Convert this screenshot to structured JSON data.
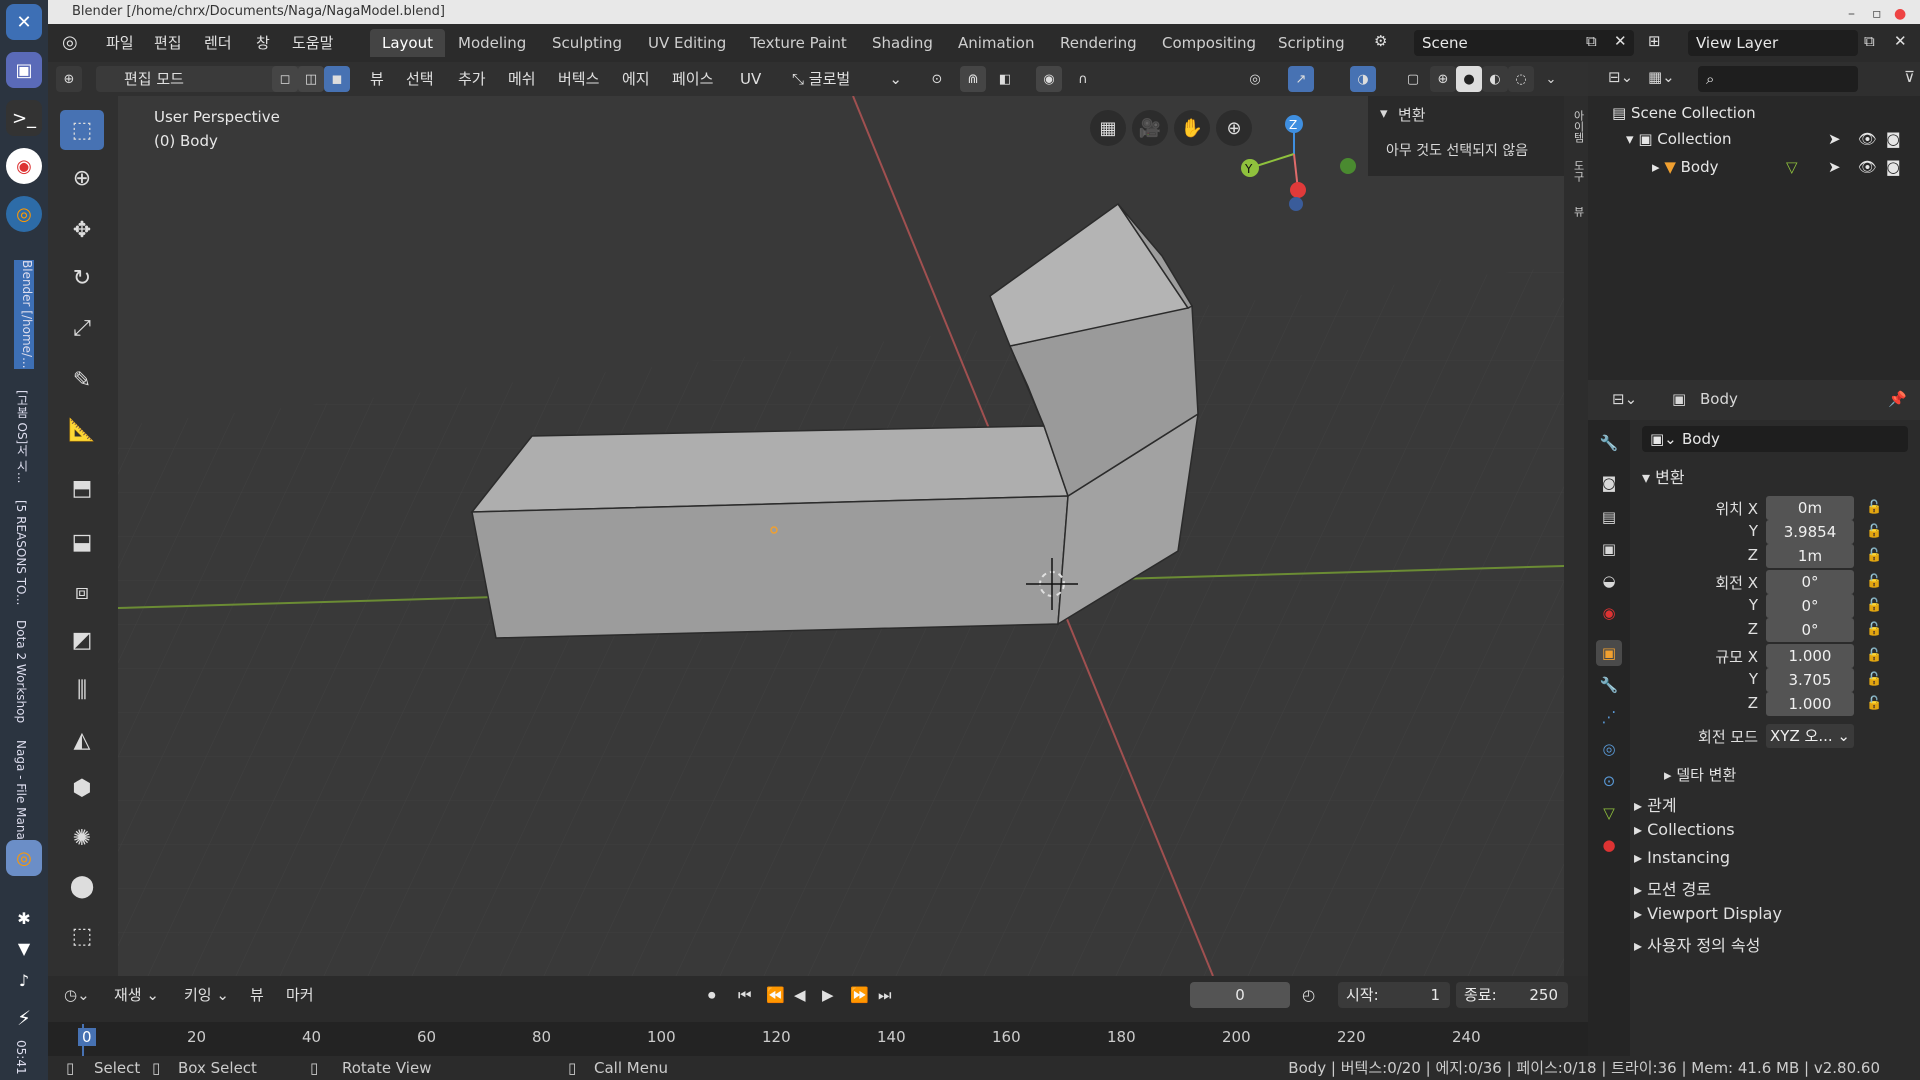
{
  "window": {
    "title": "Blender [/home/chrx/Documents/Naga/NagaModel.blend]"
  },
  "menu": [
    "파일",
    "편집",
    "렌더",
    "창",
    "도움말"
  ],
  "workspaces": [
    "Layout",
    "Modeling",
    "Sculpting",
    "UV Editing",
    "Texture Paint",
    "Shading",
    "Animation",
    "Rendering",
    "Compositing",
    "Scripting"
  ],
  "active_workspace": "Layout",
  "scene": {
    "name": "Scene",
    "view_layer": "View Layer"
  },
  "header": {
    "mode": "편집 모드",
    "menus": [
      "뷰",
      "선택",
      "추가",
      "메쉬",
      "버텍스",
      "에지",
      "페이스",
      "UV"
    ],
    "orientation": "글로벌"
  },
  "viewport": {
    "perspective": "User Perspective",
    "object": "(0) Body",
    "npanel_title": "변환",
    "npanel_msg": "아무 것도 선택되지 않음",
    "gizmo": {
      "x": "X",
      "y": "Y",
      "z": "Z"
    }
  },
  "outliner": {
    "root": "Scene Collection",
    "collection": "Collection",
    "object": "Body"
  },
  "properties": {
    "object_name": "Body",
    "datablock": "Body",
    "section_transform": "변환",
    "location_label": "위치 X",
    "rotation_label": "회전 X",
    "scale_label": "규모 X",
    "axis_y": "Y",
    "axis_z": "Z",
    "location": [
      "0m",
      "3.9854",
      "1m"
    ],
    "rotation": [
      "0°",
      "0°",
      "0°"
    ],
    "scale": [
      "1.000",
      "3.705",
      "1.000"
    ],
    "rotation_mode_label": "회전 모드",
    "rotation_mode": "XYZ 오...",
    "delta": "델타 변환",
    "sections": [
      "관계",
      "Collections",
      "Instancing",
      "모션 경로",
      "Viewport Display",
      "사용자 정의 속성"
    ]
  },
  "timeline": {
    "playback": "재생",
    "keying": "키잉",
    "view": "뷰",
    "marker": "마커",
    "current_frame": "0",
    "start_label": "시작:",
    "start": "1",
    "end_label": "종료:",
    "end": "250",
    "ticks": [
      "0",
      "20",
      "40",
      "60",
      "80",
      "100",
      "120",
      "140",
      "160",
      "180",
      "200",
      "220",
      "240"
    ]
  },
  "statusbar": {
    "select": "Select",
    "box_select": "Box Select",
    "rotate": "Rotate View",
    "call_menu": "Call Menu",
    "stats": "Body | 버텍스:0/20 | 에지:0/36 | 페이스:0/18 | 트라이:36 | Mem: 41.6 MB | v2.80.60"
  },
  "dock": {
    "vtext_1": "Blender [/home/...",
    "vtext_2": "[고봄 OS]서 시...",
    "vtext_3": "[5 REASONS TO...",
    "vtext_4": "Dota 2 Workshop",
    "vtext_5": "Naga - File Mana",
    "clock": "05:41"
  },
  "colors": {
    "accent": "#4772b3",
    "x_axis": "#e06b6b",
    "y_axis": "#8fc13d",
    "z_axis": "#3f8fe0"
  }
}
